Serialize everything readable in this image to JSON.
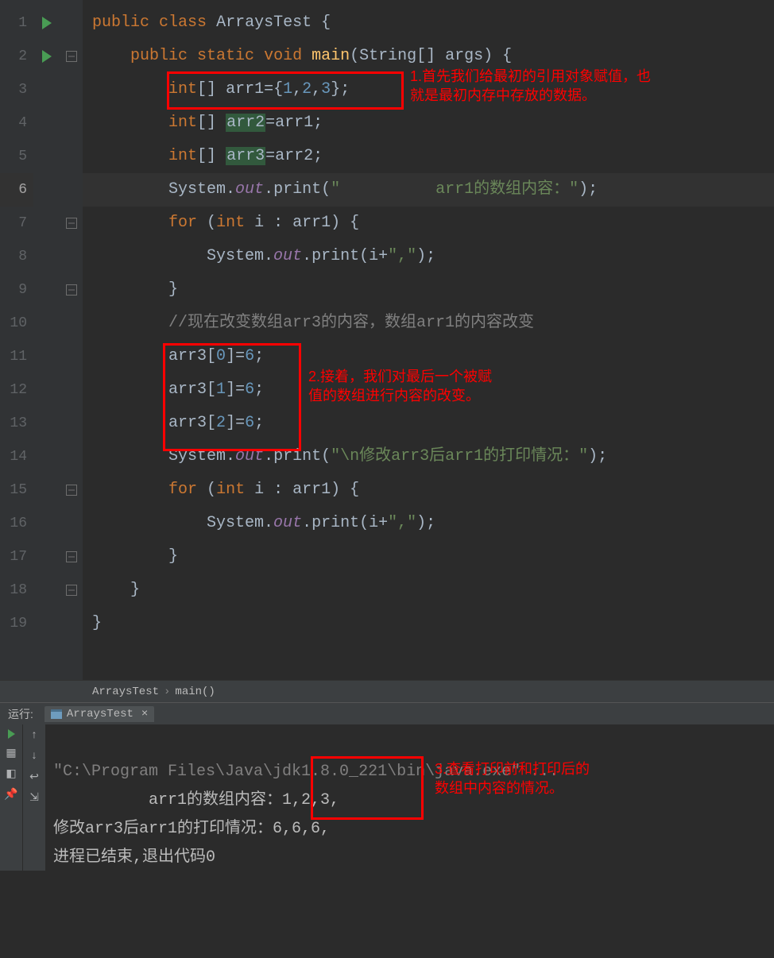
{
  "lines": [
    "1",
    "2",
    "3",
    "4",
    "5",
    "6",
    "7",
    "8",
    "9",
    "10",
    "11",
    "12",
    "13",
    "14",
    "15",
    "16",
    "17",
    "18",
    "19"
  ],
  "highlight_line": 6,
  "code": {
    "l1_kw1": "public",
    "l1_kw2": "class",
    "l1_cls": "ArraysTest",
    "l1_b": " {",
    "l2_kw1": "public",
    "l2_kw2": "static",
    "l2_kw3": "void",
    "l2_fn": "main",
    "l2_sig": "(String[] args) {",
    "l3_t": "int",
    "l3_br": "[]",
    "l3_v": "arr1",
    "l3_eq": "={",
    "l3_n1": "1",
    "l3_c1": ",",
    "l3_n2": "2",
    "l3_c2": ",",
    "l3_n3": "3",
    "l3_end": "};",
    "l4_t": "int",
    "l4_br": "[]",
    "l4_v": "arr2",
    "l4_rest": "=arr1;",
    "l5_t": "int",
    "l5_br": "[]",
    "l5_v": "arr3",
    "l5_rest": "=arr2;",
    "l6_sys": "System.",
    "l6_out": "out",
    "l6_p": ".print(",
    "l6_s": "\"          arr1的数组内容：\"",
    "l6_end": ");",
    "l7_for": "for",
    "l7_p": " (",
    "l7_t": "int",
    "l7_rest": " i : arr1) {",
    "l8_sys": "System.",
    "l8_out": "out",
    "l8_p": ".print(i+",
    "l8_s": "\",\"",
    "l8_end": ");",
    "l9": "}",
    "l10": "//现在改变数组arr3的内容，数组arr1的内容改变",
    "l11_a": "arr3[",
    "l11_i": "0",
    "l11_b": "]=",
    "l11_v": "6",
    "l11_e": ";",
    "l12_a": "arr3[",
    "l12_i": "1",
    "l12_b": "]=",
    "l12_v": "6",
    "l12_e": ";",
    "l13_a": "arr3[",
    "l13_i": "2",
    "l13_b": "]=",
    "l13_v": "6",
    "l13_e": ";",
    "l14_sys": "System.",
    "l14_out": "out",
    "l14_p": ".print(",
    "l14_s": "\"\\n修改arr3后arr1的打印情况：\"",
    "l14_end": ");",
    "l15_for": "for",
    "l15_p": " (",
    "l15_t": "int",
    "l15_rest": " i : arr1) {",
    "l16_sys": "System.",
    "l16_out": "out",
    "l16_p": ".print(i+",
    "l16_s": "\",\"",
    "l16_end": ");",
    "l17": "}",
    "l18": "}",
    "l19": "}"
  },
  "annotations": {
    "a1_l1": "1.首先我们给最初的引用对象赋值，也",
    "a1_l2": "就是最初内存中存放的数据。",
    "a2_l1": "2.接着，我们对最后一个被赋",
    "a2_l2": "值的数组进行内容的改变。",
    "a3_l1": "3.查看打印前和打印后的",
    "a3_l2": "数组中内容的情况。"
  },
  "breadcrumbs": {
    "b1": "ArraysTest",
    "b2": "main()"
  },
  "run": {
    "label": "运行:",
    "tab": "ArraysTest"
  },
  "console": {
    "c1": "\"C:\\Program Files\\Java\\jdk1.8.0_221\\bin\\java.exe\" ...",
    "c2_a": "          arr1的数组内容：",
    "c2_b": "1,2,3,",
    "c3_a": "修改arr3后arr1的打印情况：",
    "c3_b": "6,6,6,",
    "c4": "进程已结束,退出代码0"
  }
}
